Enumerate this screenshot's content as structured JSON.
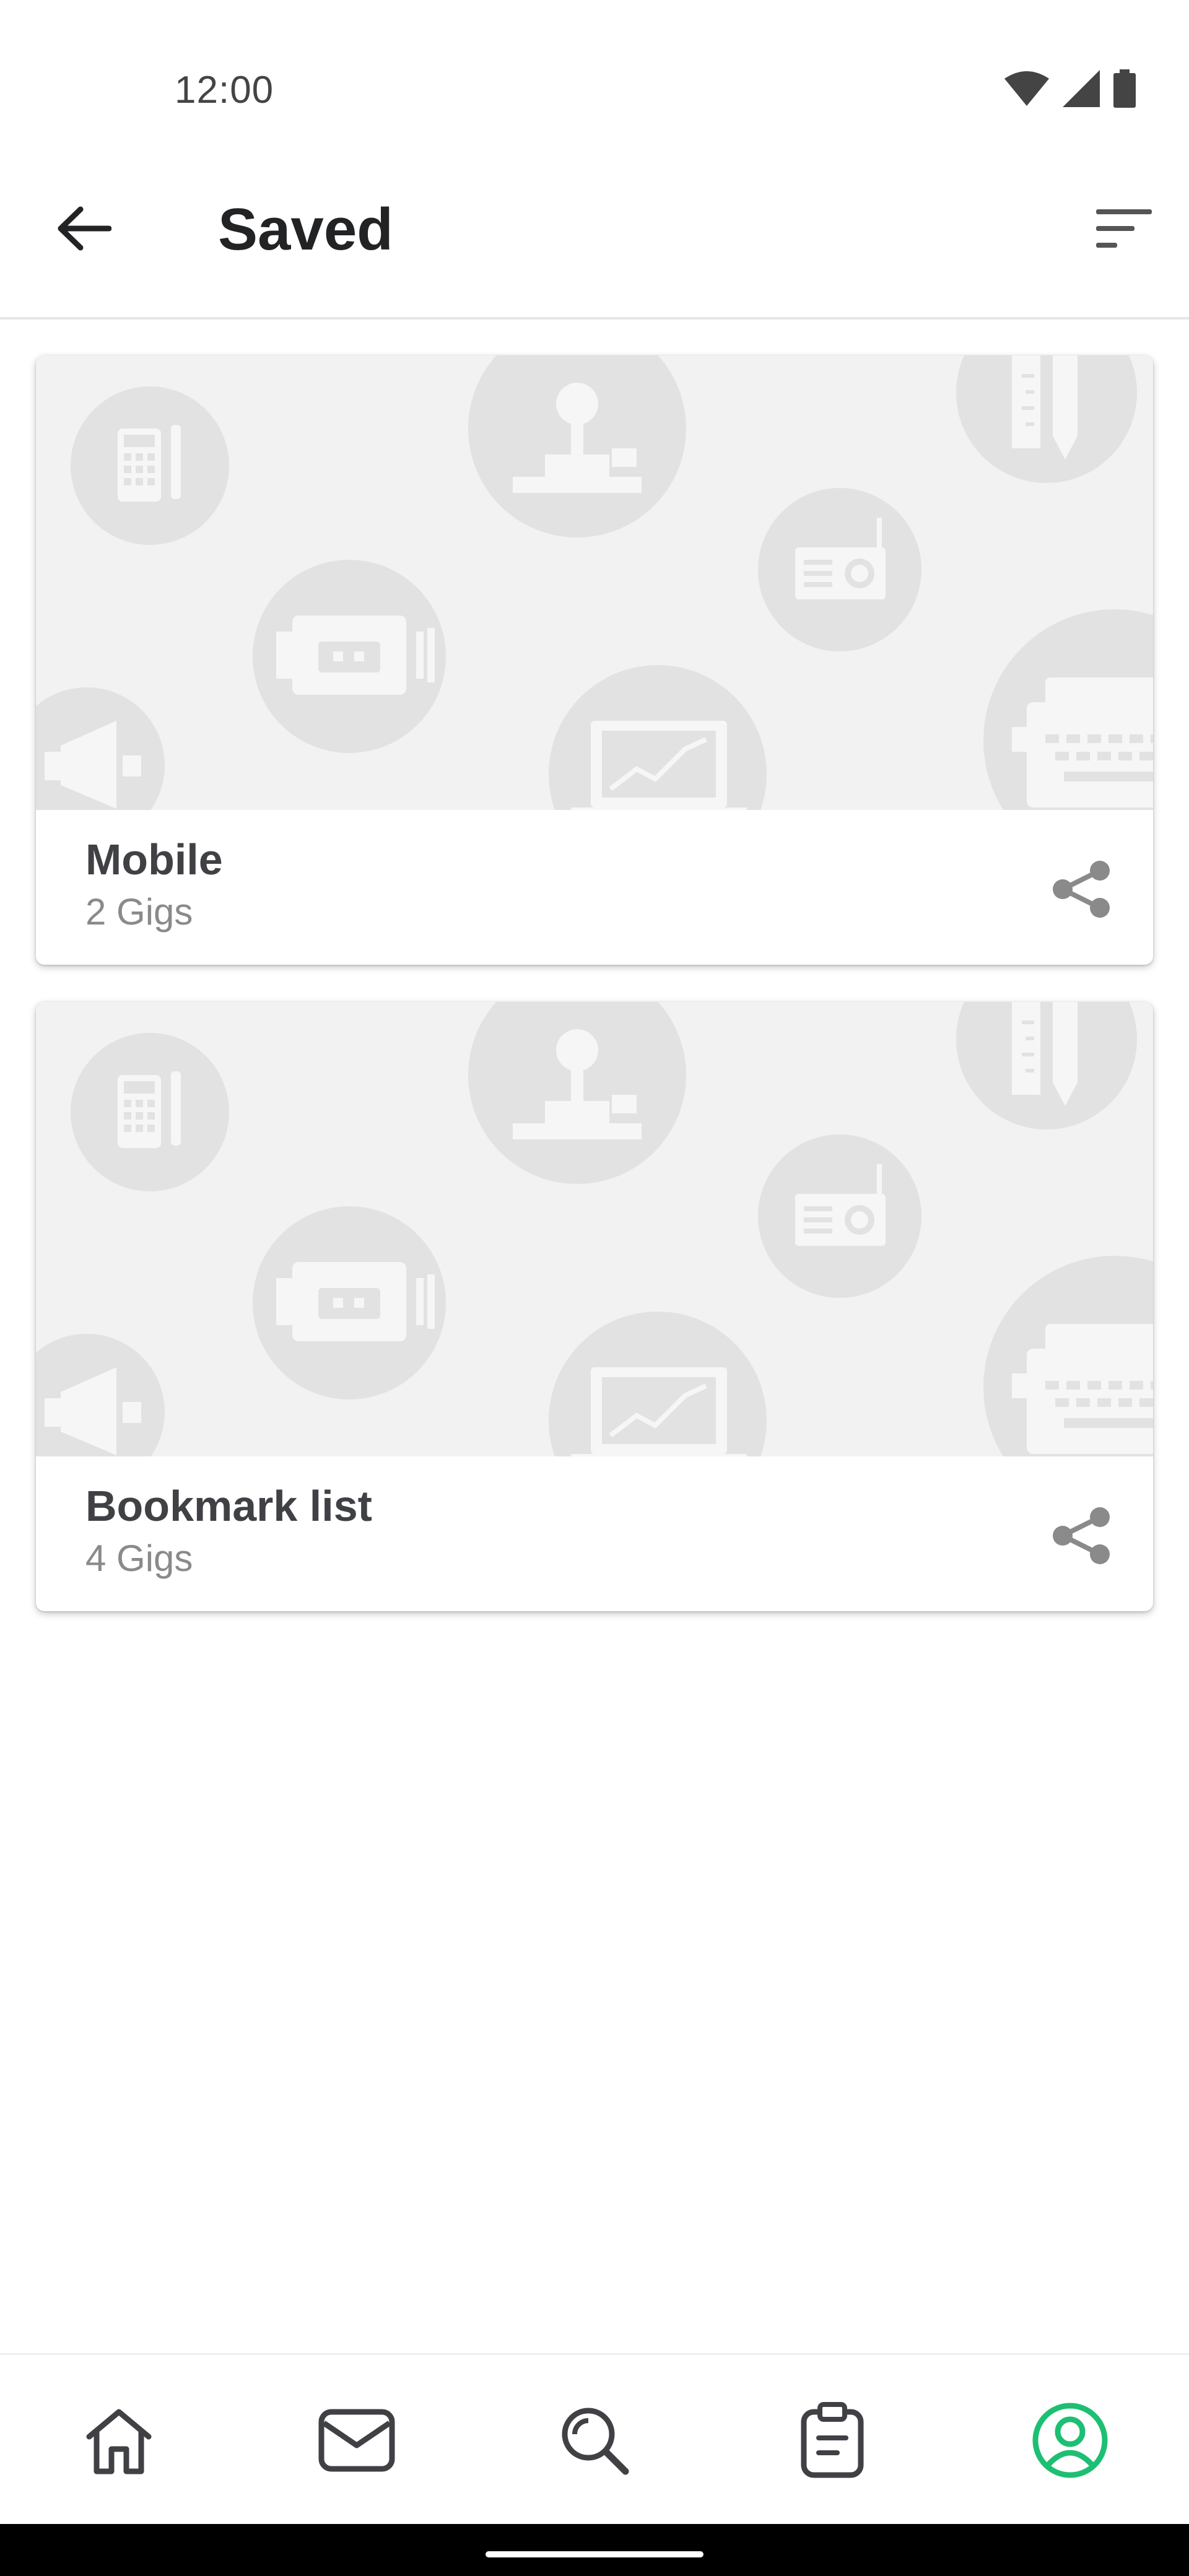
{
  "status_bar": {
    "time": "12:00",
    "icons": [
      "wifi-icon",
      "signal-icon",
      "battery-icon"
    ]
  },
  "app_bar": {
    "back_icon": "arrow-left-icon",
    "title": "Saved",
    "sort_icon": "sort-icon"
  },
  "lists": [
    {
      "title": "Mobile",
      "count": "2 Gigs",
      "share_icon": "share-icon",
      "art_icons": [
        "calculator-icon",
        "joystick-icon",
        "ruler-pencil-icon",
        "radio-icon",
        "projector-icon",
        "megaphone-icon",
        "laptop-chart-icon",
        "typewriter-icon"
      ]
    },
    {
      "title": "Bookmark list",
      "count": "4 Gigs",
      "share_icon": "share-icon",
      "art_icons": [
        "calculator-icon",
        "joystick-icon",
        "ruler-pencil-icon",
        "radio-icon",
        "projector-icon",
        "megaphone-icon",
        "laptop-chart-icon",
        "typewriter-icon"
      ]
    }
  ],
  "bottom_nav": {
    "items": [
      {
        "icon": "home-icon",
        "active": false
      },
      {
        "icon": "inbox-icon",
        "active": false
      },
      {
        "icon": "search-icon",
        "active": false
      },
      {
        "icon": "orders-clipboard-icon",
        "active": false
      },
      {
        "icon": "profile-icon",
        "active": true
      }
    ],
    "active_color": "#1dbf73",
    "inactive_color": "#404145"
  },
  "colors": {
    "title_text": "#222325",
    "card_title": "#404145",
    "card_subtitle": "#8a8a8a",
    "art_background": "#f2f2f2",
    "art_shapes": "#e2e2e2",
    "share_icon": "#8a8a8a"
  }
}
